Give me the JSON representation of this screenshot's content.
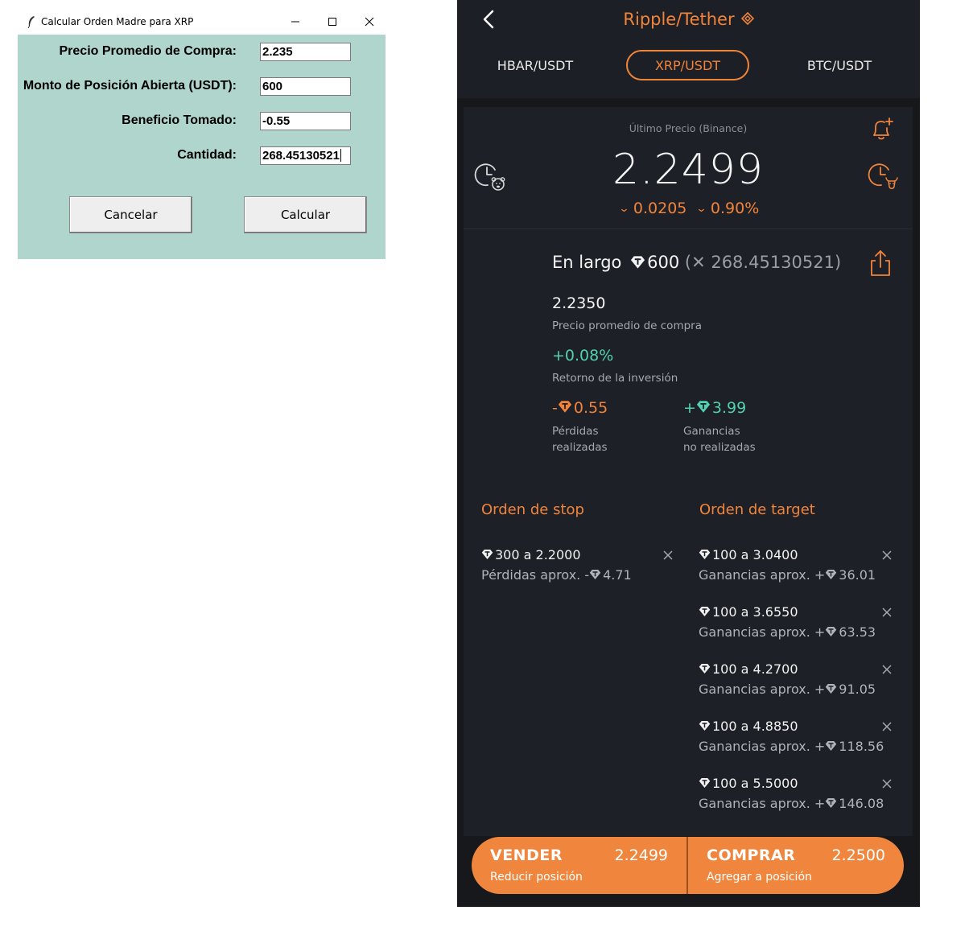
{
  "dialog": {
    "title": "Calcular Orden Madre para XRP",
    "fields": [
      {
        "label": "Precio Promedio de Compra:",
        "value": "2.235"
      },
      {
        "label": "Monto de Posición Abierta (USDT):",
        "value": "600"
      },
      {
        "label": "Beneficio Tomado:",
        "value": "-0.55"
      },
      {
        "label": "Cantidad:",
        "value": "268.45130521"
      }
    ],
    "cancel_label": "Cancelar",
    "calculate_label": "Calcular"
  },
  "app": {
    "title": "Ripple/Tether",
    "tabs": [
      "HBAR/USDT",
      "XRP/USDT",
      "BTC/USDT"
    ],
    "active_tab": "XRP/USDT",
    "last_price_label": "Último Precio (Binance)",
    "last_price": "2.2499",
    "change_abs": "0.0205",
    "change_pct": "0.90%",
    "position": {
      "side": "En largo",
      "amount": "600",
      "quantity": "(✕ 268.45130521)",
      "avg_price": "2.2350",
      "avg_price_label": "Precio promedio de compra",
      "roi": "+0.08%",
      "roi_label": "Retorno de la inversión",
      "realized_prefix": "-",
      "realized": "0.55",
      "realized_label_1": "Pérdidas",
      "realized_label_2": "realizadas",
      "unrealized_prefix": "+",
      "unrealized": "3.99",
      "unrealized_label_1": "Ganancias",
      "unrealized_label_2": "no realizadas"
    },
    "stop_heading": "Orden de stop",
    "target_heading": "Orden de target",
    "stop_orders": [
      {
        "main": "300 a 2.2000",
        "sub": "Pérdidas aprox. -",
        "amount": "4.71"
      }
    ],
    "target_orders": [
      {
        "main": "100 a 3.0400",
        "sub": "Ganancias aprox. +",
        "amount": "36.01"
      },
      {
        "main": "100 a 3.6550",
        "sub": "Ganancias aprox. +",
        "amount": "63.53"
      },
      {
        "main": "100 a 4.2700",
        "sub": "Ganancias aprox. +",
        "amount": "91.05"
      },
      {
        "main": "100 a 4.8850",
        "sub": "Ganancias aprox. +",
        "amount": "118.56"
      },
      {
        "main": "100 a 5.5000",
        "sub": "Ganancias aprox. +",
        "amount": "146.08"
      }
    ],
    "sell": {
      "label": "VENDER",
      "price": "2.2499",
      "sub": "Reducir posición"
    },
    "buy": {
      "label": "COMPRAR",
      "price": "2.2500",
      "sub": "Agregar a posición"
    },
    "colors": {
      "accent": "#f2843a",
      "positive": "#52d1b2",
      "background": "#16181c",
      "dialog_bg": "#afd5cc"
    }
  }
}
